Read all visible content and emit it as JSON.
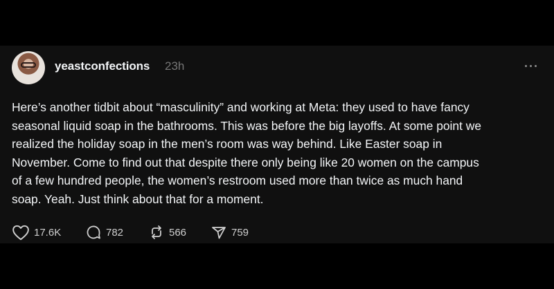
{
  "post": {
    "username": "yeastconfections",
    "time": "23h",
    "lines": [
      "Here’s another tidbit about “masculinity” and working at Meta: they used to have fancy",
      "seasonal liquid soap in the bathrooms. This was before the big layoffs. At some point we",
      "realized the holiday soap in the men’s room was way behind. Like Easter soap in",
      "November. Come to find out that despite there only being like 20 women on the campus",
      "of a few hundred people, the women’s restroom used more than twice as much hand",
      "soap. Yeah. Just think about that for a moment."
    ],
    "stats": {
      "likes": "17.6K",
      "replies": "782",
      "reposts": "566",
      "shares": "759"
    }
  },
  "colors": {
    "background": "#000000",
    "card": "#101010",
    "text": "#f3f5f7",
    "muted": "#777777"
  }
}
